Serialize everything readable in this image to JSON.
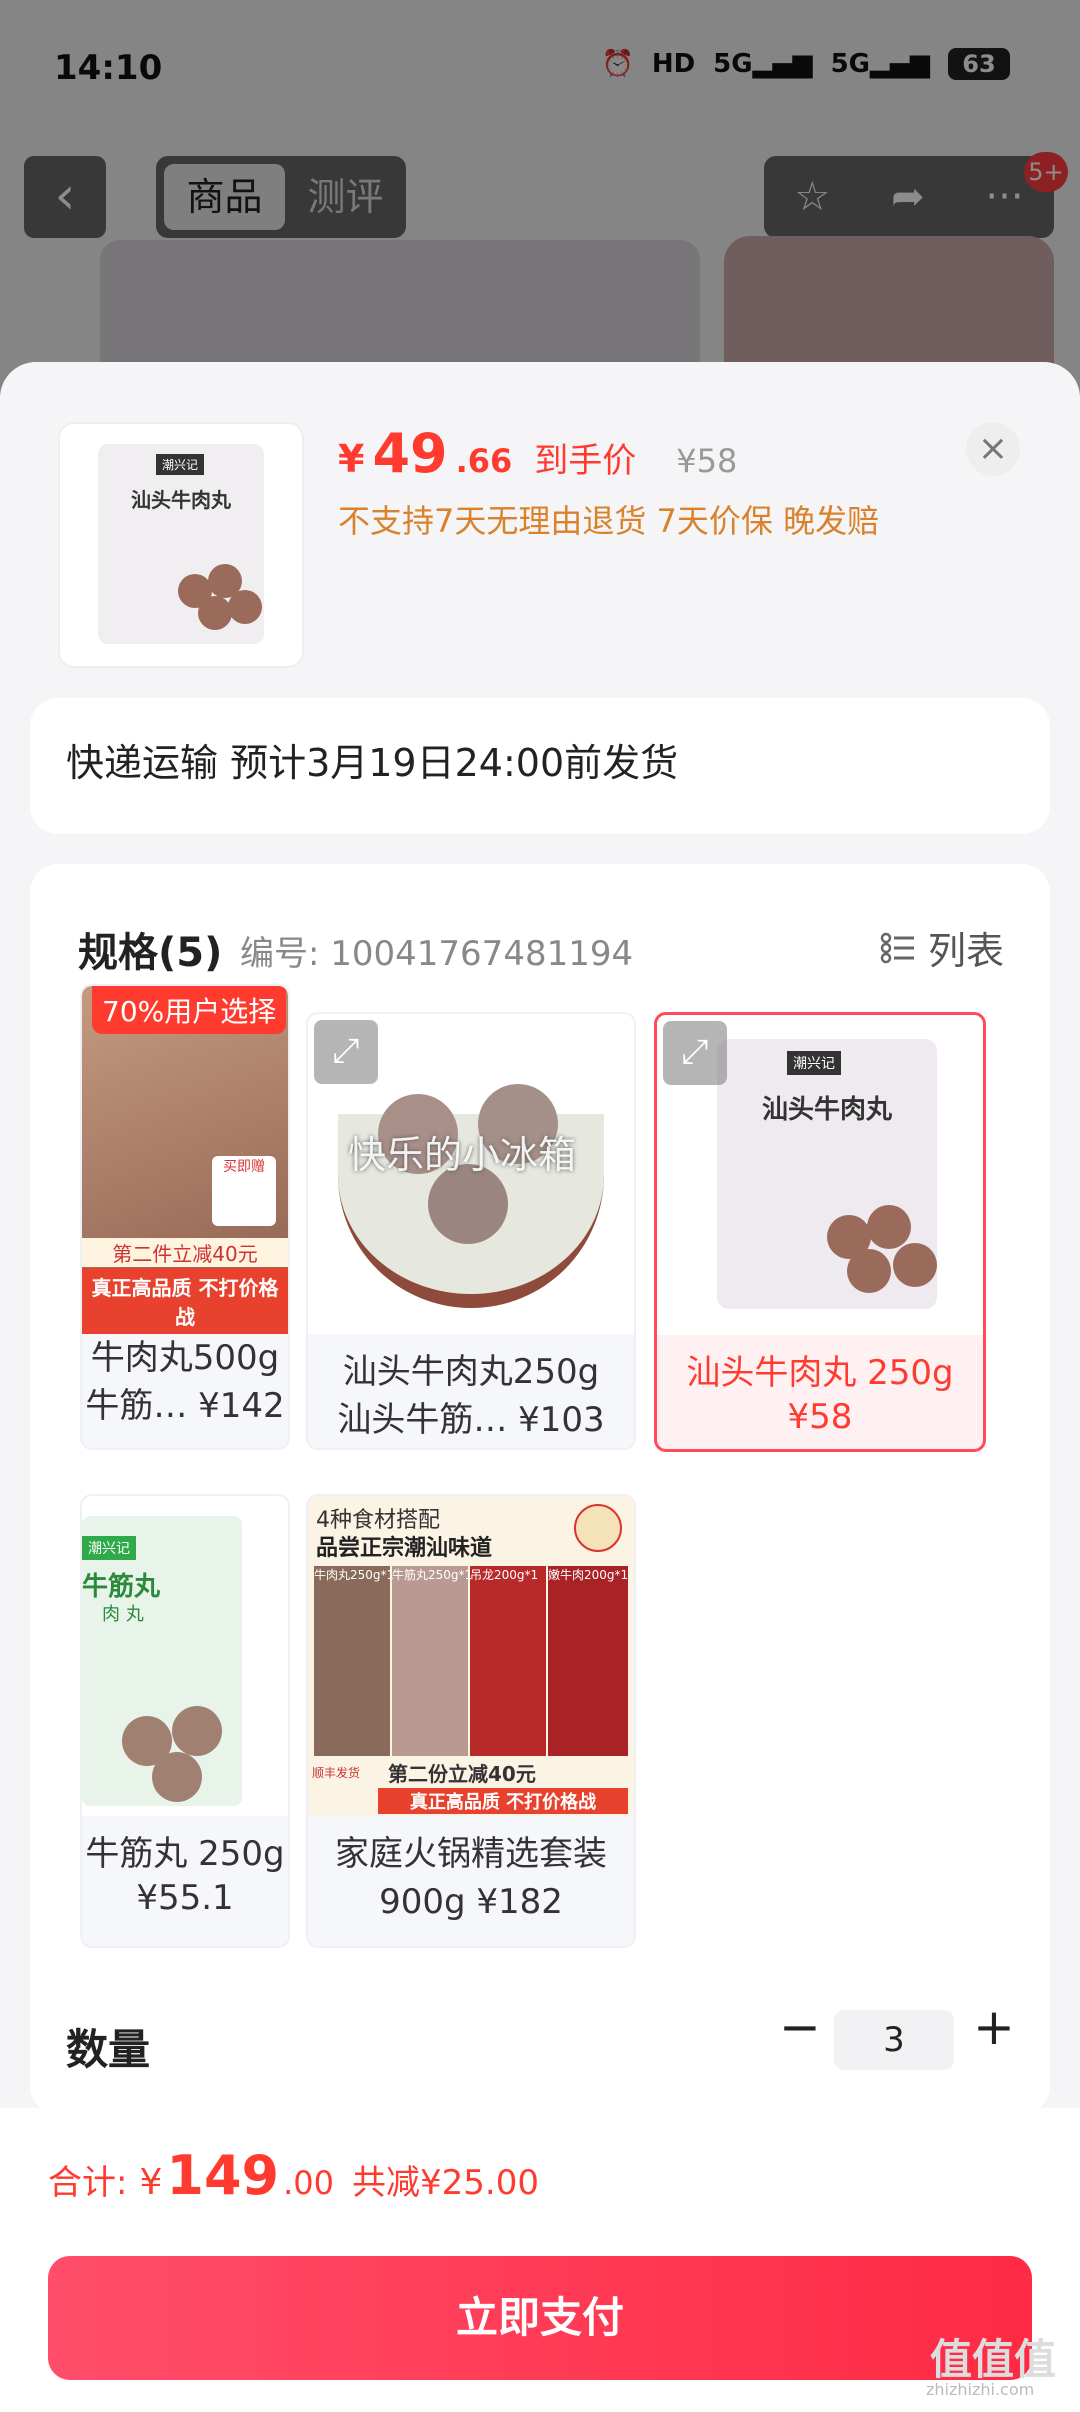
{
  "status_bar": {
    "time": "14:10",
    "icons": [
      "alarm-icon",
      "hd-icon",
      "5g-signal-icon",
      "5g-signal-icon"
    ],
    "battery": "63"
  },
  "header": {
    "tabs": [
      {
        "label": "商品"
      },
      {
        "label": "测评"
      }
    ],
    "badge": "5+"
  },
  "sheet": {
    "price": {
      "currency": "¥",
      "main": "49",
      "decimal": ".66",
      "tag": "到手价",
      "original": "¥58"
    },
    "policies": "不支持7天无理由退货  7天价保  晚发赔",
    "thumb": {
      "brand": "潮兴记",
      "title": "汕头牛肉丸"
    },
    "shipping": "快递运输 预计3月19日24:00前发货",
    "spec": {
      "title": "规格(5)",
      "sku": "编号: 10041767481194",
      "list_toggle": "列表",
      "options": [
        {
          "line1": "牛肉丸500g",
          "line2": "牛筋…  ¥142",
          "tag": "70%用户选择",
          "img_text1": "第二件立减40元",
          "img_text2": "真正高品质 不打价格战",
          "img_text3": "买即赠"
        },
        {
          "line1": "汕头牛肉丸250g",
          "line2": "汕头牛筋…  ¥103",
          "overlay": "快乐的小冰箱"
        },
        {
          "line1": "汕头牛肉丸 250g",
          "line2": "¥58",
          "img_text1": "汕头牛肉丸",
          "brand": "潮兴记"
        },
        {
          "line1": "牛筋丸 250g",
          "line2": "¥55.1",
          "img_text1": "牛筋丸",
          "img_text2": "肉 丸",
          "brand": "潮兴记"
        },
        {
          "line1": "家庭火锅精选套装",
          "line2": "900g  ¥182",
          "img_text1": "4种食材搭配",
          "img_text2": "品尝正宗潮汕味道",
          "img_text3": "第二份立减40元",
          "img_text4": "真正高品质 不打价格战",
          "labels": [
            "牛肉丸250g*1",
            "牛筋丸250g*1",
            "吊龙200g*1",
            "嫩牛肉200g*1"
          ],
          "sf": "顺丰发货"
        }
      ]
    },
    "quantity": {
      "label": "数量",
      "value": "3",
      "minus": "−",
      "plus": "+"
    }
  },
  "footer": {
    "total_label": "合计:",
    "currency": "¥",
    "total_main": "149",
    "total_decimal": ".00",
    "saved": "共减¥25.00",
    "pay_label": "立即支付"
  },
  "watermark": {
    "text": "值值值",
    "sub": "zhizhizhi.com"
  }
}
